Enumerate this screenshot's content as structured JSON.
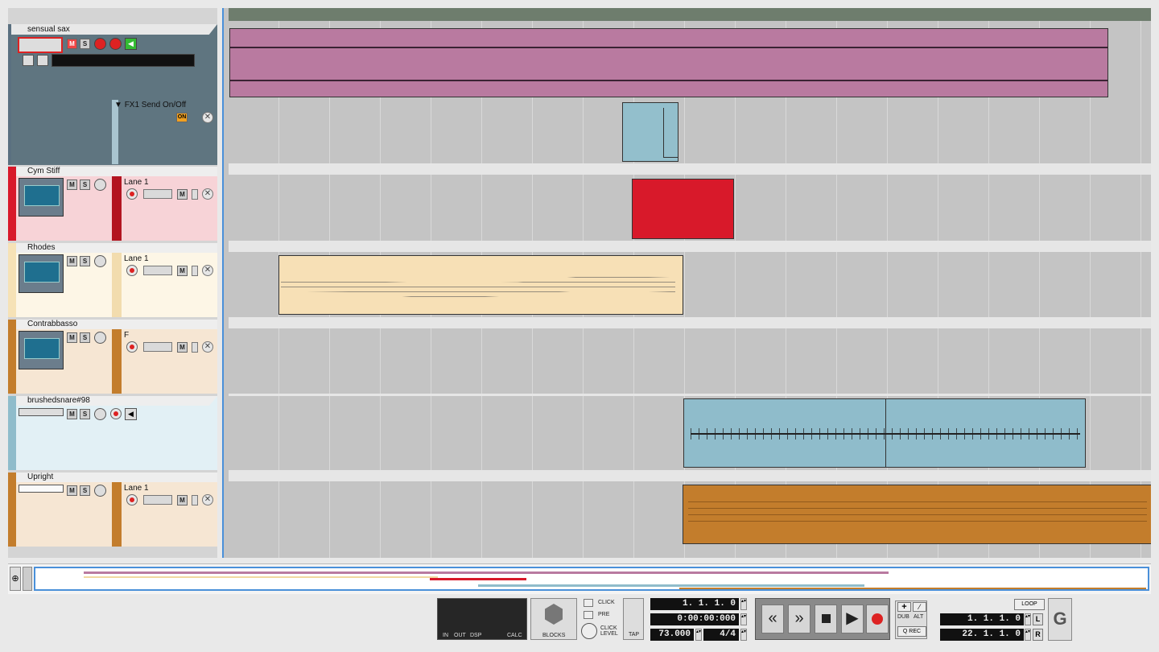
{
  "tracks": {
    "sax": {
      "name": "sensual sax",
      "mute": "M",
      "solo": "S"
    },
    "fx_lane": {
      "label": "FX1 Send On/Off",
      "on": "ON"
    },
    "cym": {
      "name": "Cym Stiff",
      "lane": "Lane 1",
      "mute": "M",
      "solo": "S"
    },
    "rhodes": {
      "name": "Rhodes",
      "lane": "Lane 1",
      "mute": "M",
      "solo": "S"
    },
    "contrabasso": {
      "name": "Contrabbasso",
      "lane": "F",
      "mute": "M",
      "solo": "S"
    },
    "brushed": {
      "name": "brushedsnare#98",
      "mute": "M",
      "solo": "S"
    },
    "upright": {
      "name": "Upright",
      "lane": "Lane 1",
      "mute": "M",
      "solo": "S"
    }
  },
  "transport": {
    "click": "CLICK",
    "pre": "PRE",
    "click_level": "CLICK LEVEL",
    "tap": "TAP",
    "blocks": "BLOCKS",
    "meter_labels": {
      "in": "IN",
      "out": "OUT",
      "dsp": "DSP",
      "calc": "CALC"
    },
    "position_bars": "1. 1. 1.   0",
    "position_time": "0:00:00:000",
    "tempo": "73.000",
    "signature": "4/4",
    "dub": "DUB",
    "alt": "ALT",
    "q_rec": "Q REC",
    "loop": "LOOP",
    "left_locator": "1. 1. 1.   0",
    "right_locator": "22. 1. 1.   0",
    "l": "L",
    "r": "R"
  },
  "colors": {
    "sax_clip": "#b97aa0",
    "fx_clip": "#93bfcc",
    "cym_clip": "#d8192a",
    "rhodes_clip": "#f7e0b6",
    "brushed_clip": "#8fbccb",
    "upright_clip": "#c37d2c"
  }
}
